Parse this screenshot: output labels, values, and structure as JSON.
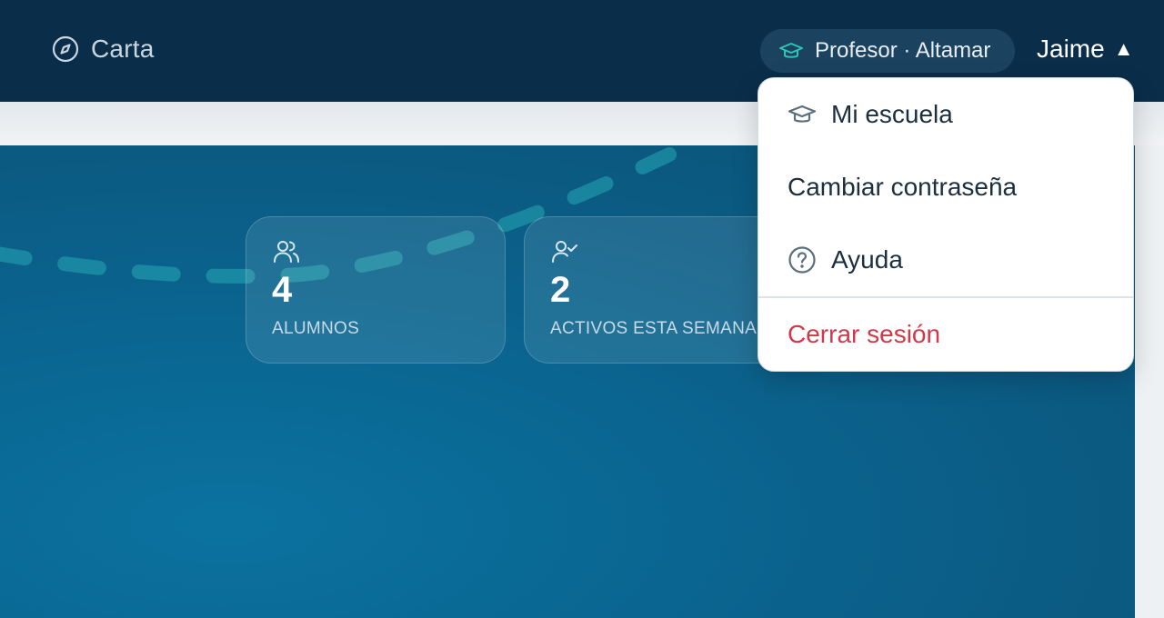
{
  "nav": {
    "brand_label": "Carta",
    "brand_icon": "compass-icon",
    "role_label": "Profesor · Altamar",
    "role_icon": "graduation-cap-icon",
    "user_name": "Jaime",
    "user_caret": "▲"
  },
  "stats": [
    {
      "value": "4",
      "label": "ALUMNOS",
      "icon": "users-icon"
    },
    {
      "value": "2",
      "label": "ACTIVOS ESTA SEMANA",
      "icon": "user-check-icon"
    }
  ],
  "user_menu": {
    "items": [
      {
        "label": "Mi escuela",
        "icon": "graduation-cap-icon"
      },
      {
        "label": "Cambiar contraseña"
      },
      {
        "label": "Ayuda",
        "icon": "help-circle-icon"
      },
      {
        "label": "Cerrar sesión",
        "color": "#d1384a"
      }
    ]
  },
  "colors": {
    "nav_bg": "#0a2d4a",
    "accent_teal": "#2ec4b6",
    "hero_bg": "#0a6691",
    "danger": "#d1384a"
  }
}
